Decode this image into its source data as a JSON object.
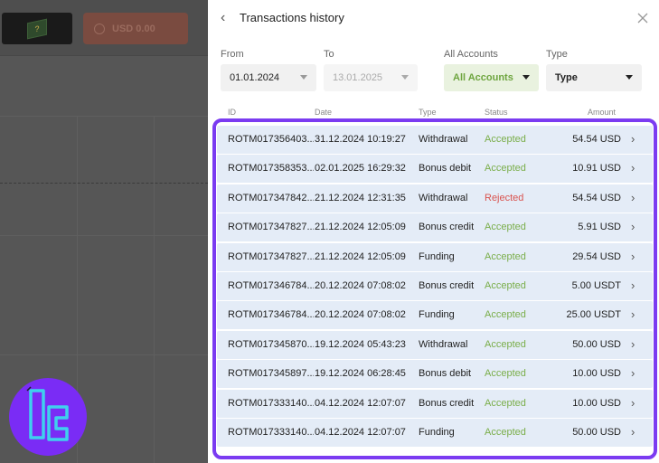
{
  "background": {
    "balance": "USD 0.00",
    "logo_glyph": "?"
  },
  "panel": {
    "title": "Transactions history",
    "filters": {
      "from_label": "From",
      "from_value": "01.01.2024",
      "to_label": "To",
      "to_value": "13.01.2025",
      "accounts_label": "All Accounts",
      "accounts_value": "All Accounts",
      "type_label": "Type",
      "type_value": "Type"
    },
    "columns": {
      "id": "ID",
      "date": "Date",
      "type": "Type",
      "status": "Status",
      "amount": "Amount"
    },
    "rows": [
      {
        "id": "ROTM017356403...",
        "date": "31.12.2024 10:19:27",
        "type": "Withdrawal",
        "status": "Accepted",
        "amount": "54.54 USD"
      },
      {
        "id": "ROTM017358353...",
        "date": "02.01.2025 16:29:32",
        "type": "Bonus debit",
        "status": "Accepted",
        "amount": "10.91 USD"
      },
      {
        "id": "ROTM017347842...",
        "date": "21.12.2024 12:31:35",
        "type": "Withdrawal",
        "status": "Rejected",
        "amount": "54.54 USD"
      },
      {
        "id": "ROTM017347827...",
        "date": "21.12.2024 12:05:09",
        "type": "Bonus credit",
        "status": "Accepted",
        "amount": "5.91 USD"
      },
      {
        "id": "ROTM017347827...",
        "date": "21.12.2024 12:05:09",
        "type": "Funding",
        "status": "Accepted",
        "amount": "29.54 USD"
      },
      {
        "id": "ROTM017346784...",
        "date": "20.12.2024 07:08:02",
        "type": "Bonus credit",
        "status": "Accepted",
        "amount": "5.00 USDT"
      },
      {
        "id": "ROTM017346784...",
        "date": "20.12.2024 07:08:02",
        "type": "Funding",
        "status": "Accepted",
        "amount": "25.00 USDT"
      },
      {
        "id": "ROTM017345870...",
        "date": "19.12.2024 05:43:23",
        "type": "Withdrawal",
        "status": "Accepted",
        "amount": "50.00 USD"
      },
      {
        "id": "ROTM017345897...",
        "date": "19.12.2024 06:28:45",
        "type": "Bonus debit",
        "status": "Accepted",
        "amount": "10.00 USD"
      },
      {
        "id": "ROTM017333140...",
        "date": "04.12.2024 12:07:07",
        "type": "Bonus credit",
        "status": "Accepted",
        "amount": "10.00 USD"
      },
      {
        "id": "ROTM017333140...",
        "date": "04.12.2024 12:07:07",
        "type": "Funding",
        "status": "Accepted",
        "amount": "50.00 USD"
      }
    ]
  },
  "colors": {
    "accepted": "#7aae4a",
    "rejected": "#d9534f",
    "highlight": "#7b3bf1",
    "row_bg": "#e4ecf7"
  },
  "icons": {
    "back": "chevron-left-icon",
    "close": "close-icon",
    "row_chevron": "chevron-right-icon",
    "dropdown": "caret-down-icon"
  }
}
